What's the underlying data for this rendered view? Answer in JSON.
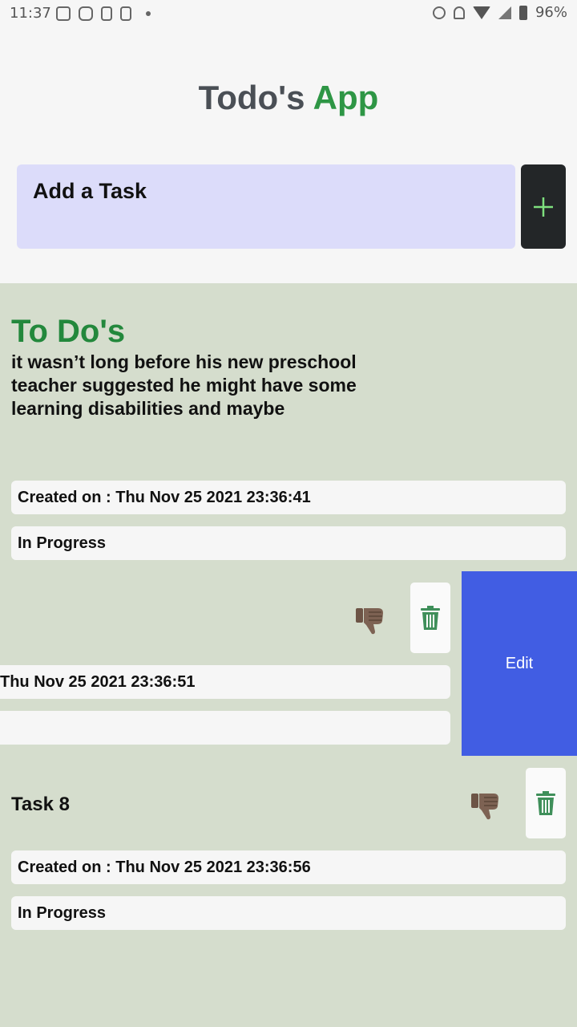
{
  "status_bar": {
    "time": "11:37",
    "battery": "96%",
    "left_icons": [
      "news-icon",
      "instagram-icon",
      "app-icon",
      "app-icon",
      "dot-icon"
    ],
    "right_icons": [
      "alarm-icon",
      "bell-off-icon",
      "wifi-icon",
      "signal-icon",
      "battery-icon"
    ]
  },
  "header": {
    "title_part1": "Todo's",
    "title_part2": "App",
    "title_colors": {
      "part1": "#4a4f55",
      "part2": "#2e9645"
    }
  },
  "input": {
    "placeholder": "Add a Task",
    "add_button_icon": "plus-icon",
    "add_button_color": "#7ee07e"
  },
  "list": {
    "section_title": "To Do's",
    "tasks": [
      {
        "description": "it wasn’t long before his new preschool teacher suggested he might have some learning disabilities and maybe",
        "created_on": "Created on : Thu Nov 25 2021 23:36:41",
        "status": "In Progress"
      },
      {
        "created_on": "Thu Nov 25 2021 23:36:51",
        "status": "",
        "swipe_action_label": "Edit",
        "icons": [
          "thumbs-down-icon",
          "trash-icon"
        ]
      },
      {
        "title": "Task 8",
        "created_on": "Created on : Thu Nov 25 2021 23:36:56",
        "status": "In Progress",
        "icons": [
          "thumbs-down-icon",
          "trash-icon"
        ]
      }
    ]
  },
  "colors": {
    "list_background": "#d5ddcd",
    "input_background": "#dcdcfa",
    "edit_action": "#415de3",
    "trash_icon": "#3f8f5a",
    "section_title": "#23883c"
  }
}
